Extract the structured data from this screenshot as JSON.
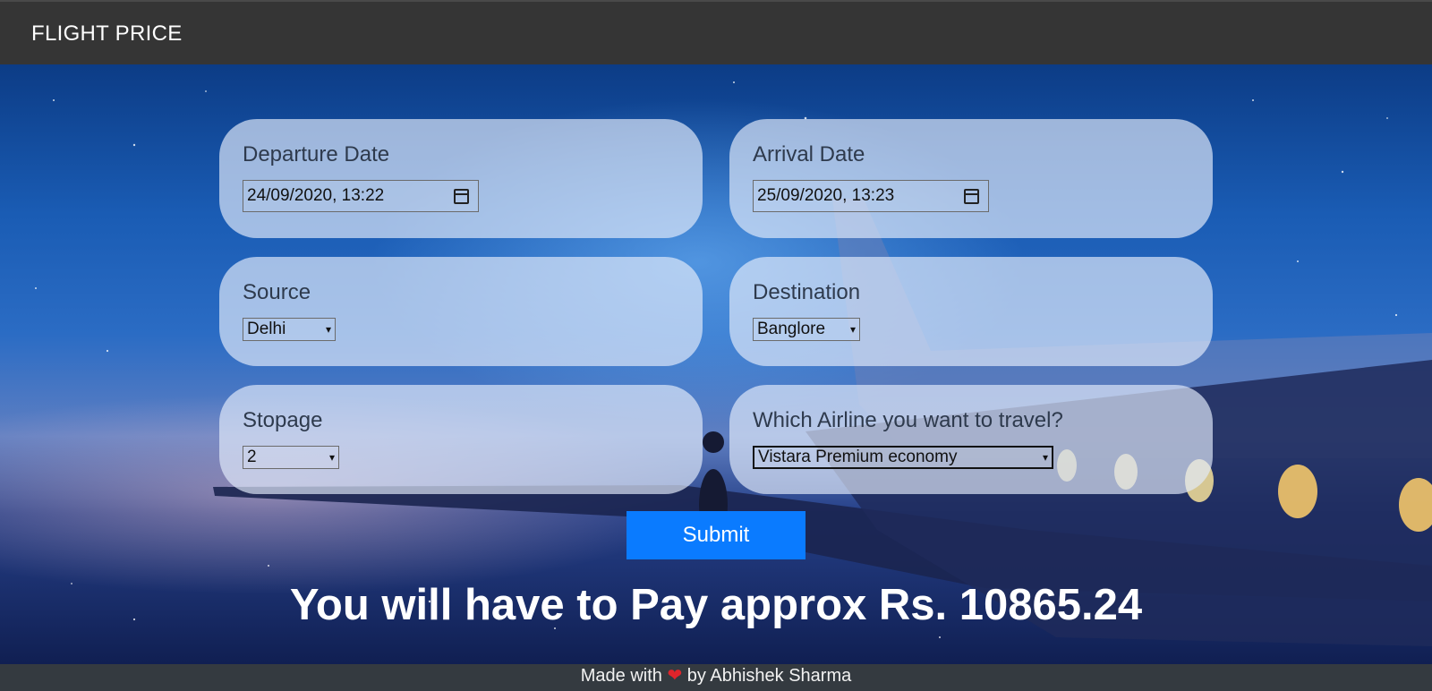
{
  "header": {
    "brand": "FLIGHT PRICE"
  },
  "form": {
    "departure": {
      "label": "Departure Date",
      "value": "24/09/2020, 13:22"
    },
    "arrival": {
      "label": "Arrival Date",
      "value": "25/09/2020, 13:23"
    },
    "source": {
      "label": "Source",
      "value": "Delhi"
    },
    "destination": {
      "label": "Destination",
      "value": "Banglore"
    },
    "stopage": {
      "label": "Stopage",
      "value": "2"
    },
    "airline": {
      "label": "Which Airline you want to travel?",
      "value": "Vistara Premium economy"
    },
    "submit_label": "Submit"
  },
  "result": {
    "text": "You will have to Pay approx Rs. 10865.24"
  },
  "footer": {
    "prefix": "Made with",
    "heart": "❤",
    "suffix": "by Abhishek Sharma"
  },
  "icons": {
    "date_picker": "calendar-icon",
    "dropdown": "chevron-down-icon",
    "love": "heart-icon"
  },
  "colors": {
    "submit_bg": "#0a7bff",
    "topbar": "#353535",
    "footer": "#343a40",
    "heart": "#e0242b"
  }
}
